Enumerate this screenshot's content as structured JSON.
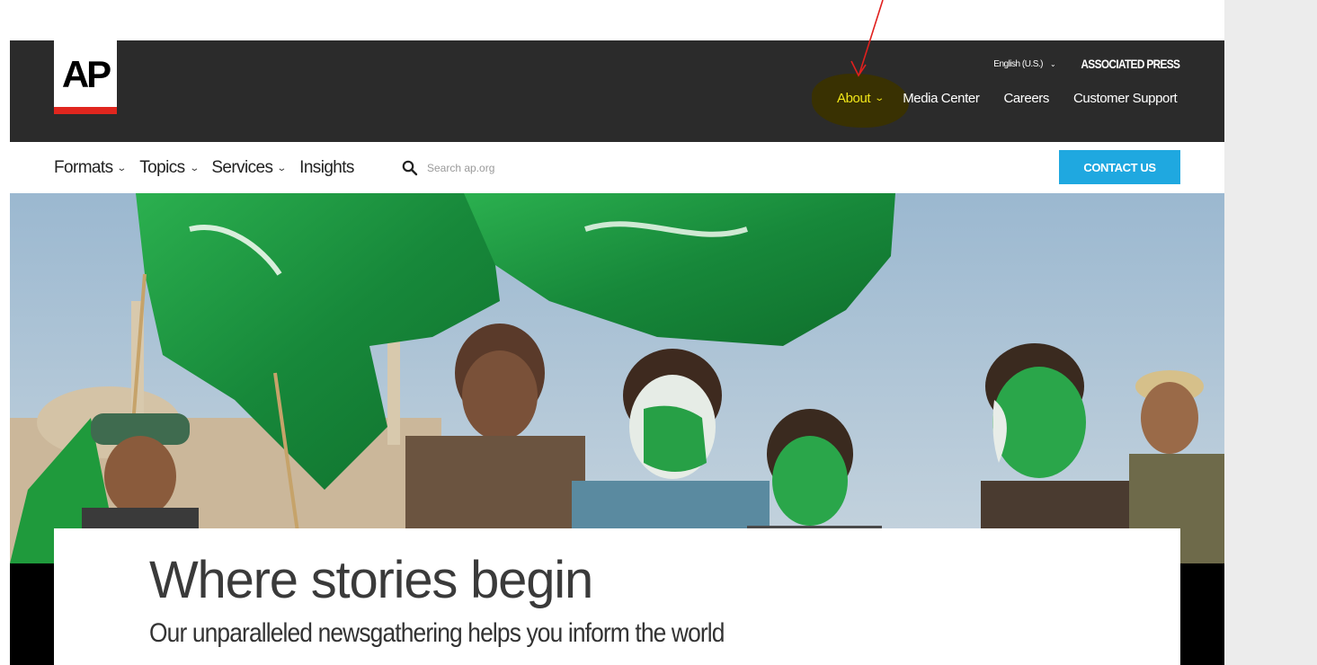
{
  "header": {
    "logo_text": "AP",
    "language_selector": "English (U.S.)",
    "brand_name": "ASSOCIATED PRESS",
    "utility_nav": [
      {
        "label": "About"
      },
      {
        "label": "Media Center"
      },
      {
        "label": "Careers"
      },
      {
        "label": "Customer Support"
      }
    ]
  },
  "main_nav": {
    "items": [
      {
        "label": "Formats"
      },
      {
        "label": "Topics"
      },
      {
        "label": "Services"
      },
      {
        "label": "Insights"
      }
    ],
    "search_placeholder": "Search ap.org",
    "contact_label": "CONTACT US"
  },
  "hero": {
    "title": "Where stories begin",
    "subtitle": "Our unparalleled newsgathering helps you inform the world"
  },
  "icons": {
    "search": "search-icon",
    "dropdown": "chevron-down-icon",
    "annotation": "red-arrow-icon"
  },
  "colors": {
    "header_bg": "#2b2b2b",
    "about_active": "#f1e619",
    "logo_red": "#e0261e",
    "contact_button": "#1fa8e0",
    "annotation_arrow": "#e0201e",
    "annotation_highlight": "#3a3200",
    "flag_green": "#1f9a3c"
  }
}
